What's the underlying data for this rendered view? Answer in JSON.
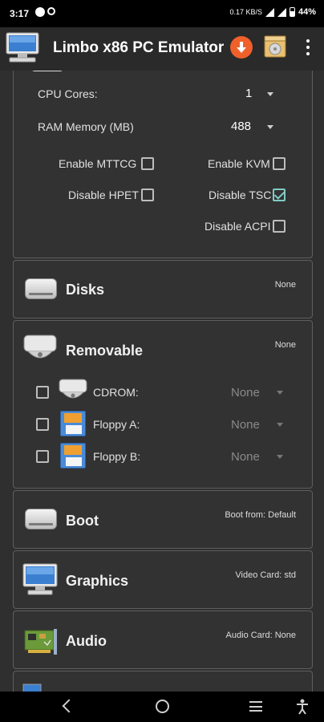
{
  "status_bar": {
    "time": "3:17",
    "battery_text": "44%",
    "data_rate": "0.17 KB/S"
  },
  "app_bar": {
    "title": "Limbo x86 PC Emulator"
  },
  "cpu_section": {
    "cpu_cores_label": "CPU Cores:",
    "cpu_cores_value": "1",
    "ram_label": "RAM Memory (MB)",
    "ram_value": "488",
    "enable_mttcg_label": "Enable  MTTCG",
    "enable_mttcg_checked": false,
    "enable_kvm_label": "Enable KVM",
    "enable_kvm_checked": false,
    "disable_hpet_label": "Disable HPET",
    "disable_hpet_checked": false,
    "disable_tsc_label": "Disable TSC",
    "disable_tsc_checked": true,
    "disable_acpi_label": "Disable ACPI",
    "disable_acpi_checked": false
  },
  "disks": {
    "title": "Disks",
    "note": "None"
  },
  "removable": {
    "title": "Removable",
    "note": "None",
    "items": [
      {
        "label": "CDROM:",
        "value": "None",
        "checked": false,
        "icon": "cdrom-drive-icon"
      },
      {
        "label": "Floppy A:",
        "value": "None",
        "checked": false,
        "icon": "floppy-disk-icon"
      },
      {
        "label": "Floppy B:",
        "value": "None",
        "checked": false,
        "icon": "floppy-disk-icon"
      }
    ]
  },
  "boot": {
    "title": "Boot",
    "note": "Boot from: Default"
  },
  "graphics": {
    "title": "Graphics",
    "note": "Video Card: std"
  },
  "audio": {
    "title": "Audio",
    "note": "Audio Card: None"
  },
  "colors": {
    "accent_check": "#80cbc4",
    "download_button": "#f0602a",
    "app_bar": "#2a2a2a",
    "panel": "#323232"
  }
}
